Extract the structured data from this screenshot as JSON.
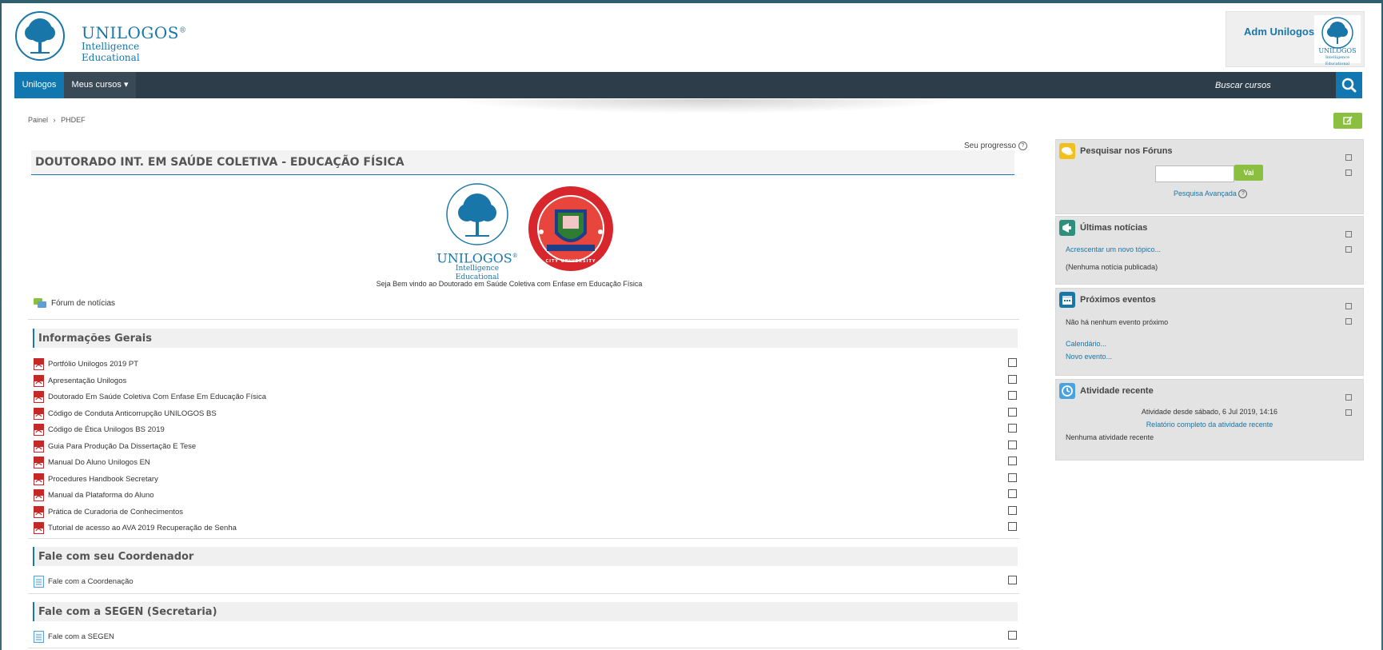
{
  "header": {
    "logo": {
      "brand": "UNILOGOS",
      "registered": "®",
      "tagline": "Intelligence Educational"
    },
    "user": {
      "name": "Adm Unilogos",
      "caret": "▾"
    }
  },
  "navbar": {
    "home": "Unilogos",
    "courses": "Meus cursos ▾",
    "search_placeholder": "Buscar cursos"
  },
  "breadcrumb": {
    "home": "Painel",
    "separator": "›",
    "current": "PHDEF"
  },
  "course": {
    "progress_label": "Seu progresso",
    "title": "DOUTORADO INT. EM SAÚDE COLETIVA - EDUCAÇÃO FÍSICA",
    "welcome": "Seja Bem vindo ao Doutorado em Saúde Coletiva com Enfase em Educação Física",
    "forum": "Fórum de notícias",
    "logo_left": {
      "brand": "UNILOGOS",
      "registered": "®",
      "tagline": "Intelligence Educational"
    },
    "logo_right": {
      "ribbon": "CITY UNIVERSITY"
    }
  },
  "sections": [
    {
      "title": "Informações Gerais",
      "items": [
        "Portfólio Unilogos 2019 PT",
        "Apresentação Unilogos",
        "Doutorado Em Saúde Coletiva Com Enfase Em Educação Física",
        "Código de Conduta Anticorrupção UNILOGOS BS",
        "Código de Ética Unilogos BS 2019",
        "Guia Para Produção Da Dissertação E Tese",
        "Manual Do Aluno Unilogos EN",
        "Procedures Handbook Secretary",
        "Manual da Plataforma do Aluno",
        "Prática de Curadoria de Conhecimentos",
        "Tutorial de acesso ao AVA 2019 Recuperação de Senha"
      ]
    },
    {
      "title": "Fale com seu Coordenador",
      "items": [
        "Fale com a Coordenação"
      ]
    },
    {
      "title": "Fale com a SEGEN (Secretaria)",
      "items": [
        "Fale com a SEGEN"
      ]
    }
  ],
  "blocks": {
    "forum_search": {
      "title": "Pesquisar nos Fóruns",
      "button": "Vai",
      "advanced": "Pesquisa Avançada"
    },
    "news": {
      "title": "Últimas notícias",
      "add": "Acrescentar um novo tópico...",
      "empty": "(Nenhuma notícia publicada)"
    },
    "events": {
      "title": "Próximos eventos",
      "empty": "Não há nenhum evento próximo",
      "calendar": "Calendário...",
      "new_event": "Novo evento..."
    },
    "recent": {
      "title": "Atividade recente",
      "since": "Atividade desde sábado, 6 Jul 2019, 14:16",
      "report": "Relatório completo da atividade recente",
      "none": "Nenhuma atividade recente"
    }
  },
  "colors": {
    "accent": "#1177b0",
    "navbar": "#2e3d4a",
    "go_button": "#8bbf3f",
    "pdf": "#c62828"
  }
}
